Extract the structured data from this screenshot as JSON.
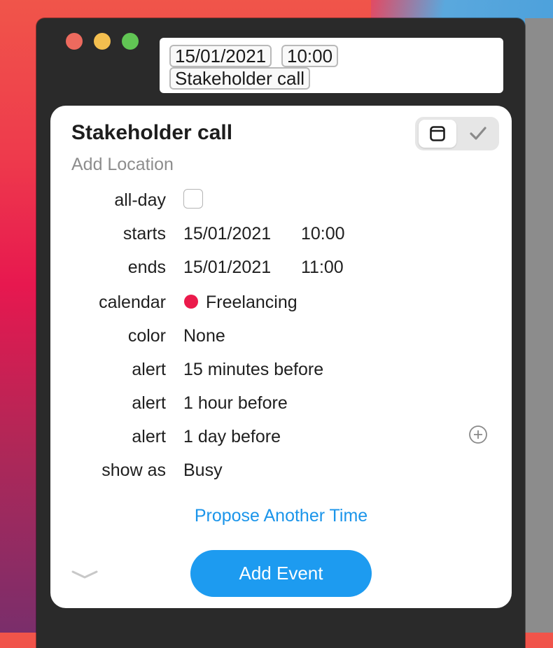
{
  "input_bar": {
    "date_token": "15/01/2021",
    "time_token": "10:00",
    "title_token": "Stakeholder call"
  },
  "event": {
    "title": "Stakeholder call",
    "location_placeholder": "Add Location"
  },
  "fields": {
    "all_day_label": "all-day",
    "all_day_checked": false,
    "starts_label": "starts",
    "starts_date": "15/01/2021",
    "starts_time": "10:00",
    "ends_label": "ends",
    "ends_date": "15/01/2021",
    "ends_time": "11:00",
    "calendar_label": "calendar",
    "calendar_value": "Freelancing",
    "calendar_color": "#eb1a4b",
    "color_label": "color",
    "color_value": "None",
    "alerts": [
      {
        "label": "alert",
        "value": "15 minutes before"
      },
      {
        "label": "alert",
        "value": "1 hour before"
      },
      {
        "label": "alert",
        "value": "1 day before"
      }
    ],
    "show_as_label": "show as",
    "show_as_value": "Busy"
  },
  "actions": {
    "propose_label": "Propose Another Time",
    "add_event_label": "Add Event"
  },
  "colors": {
    "accent": "#1d9bf0",
    "link": "#1b95ea"
  },
  "icons": {
    "segment_left": "calendar-icon",
    "segment_right": "checkmark-icon",
    "add_alert": "plus-circle-icon",
    "expand": "chevron-down-icon"
  }
}
